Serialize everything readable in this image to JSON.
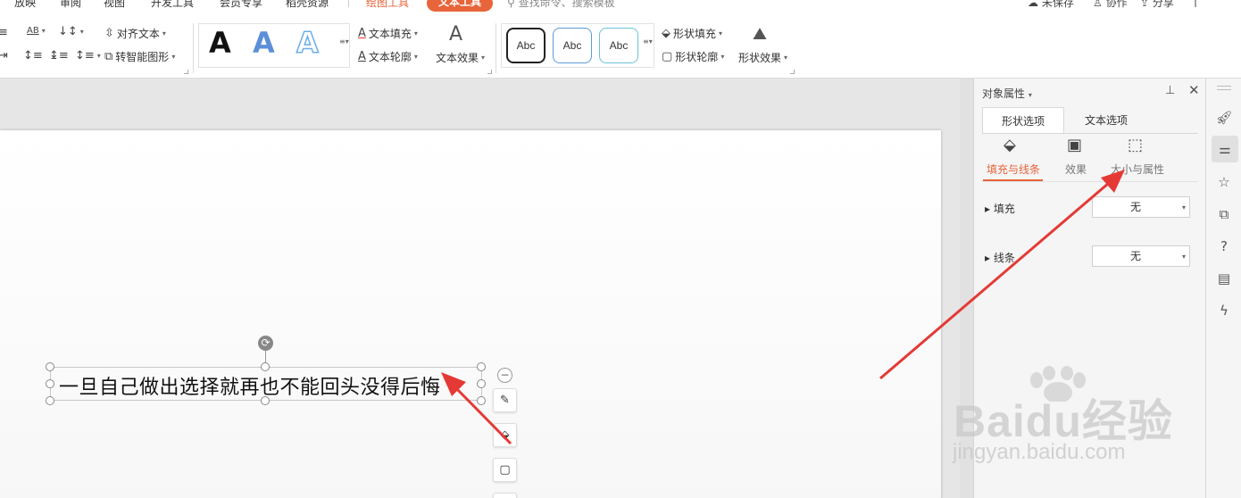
{
  "menu": {
    "tabs": [
      "放映",
      "审阅",
      "视图",
      "开发工具",
      "会员专享",
      "稻壳资源"
    ],
    "drawing_tools": "绘图工具",
    "text_tools": "文本工具",
    "search": "查找命令、搜索模板",
    "actions": {
      "unsaved": "未保存",
      "collaborate": "协作",
      "share": "分享"
    }
  },
  "ribbon": {
    "align_text": "对齐文本",
    "smart_shape": "转智能图形",
    "text_fill": "文本填充",
    "text_outline": "文本轮廓",
    "text_effect": "文本效果",
    "shape_fill": "形状填充",
    "shape_outline": "形状轮廓",
    "shape_effect": "形状效果",
    "font_case_label": "AB",
    "art_letters": [
      "A",
      "A",
      "A"
    ],
    "shape_styles": [
      "Abc",
      "Abc",
      "Abc"
    ]
  },
  "slide": {
    "textbox_text": "一旦自己做出选择就再也不能回头没得后悔"
  },
  "pane": {
    "title": "对象属性",
    "tabs": [
      "形状选项",
      "文本选项"
    ],
    "subtabs": [
      "填充与线条",
      "效果",
      "大小与属性"
    ],
    "fill_label": "填充",
    "fill_value": "无",
    "line_label": "线条",
    "line_value": "无"
  },
  "watermark": {
    "main": "Baidu经验",
    "sub": "jingyan.baidu.com"
  },
  "colors": {
    "accent": "#e8643a",
    "annotation_arrow": "#e53935"
  }
}
